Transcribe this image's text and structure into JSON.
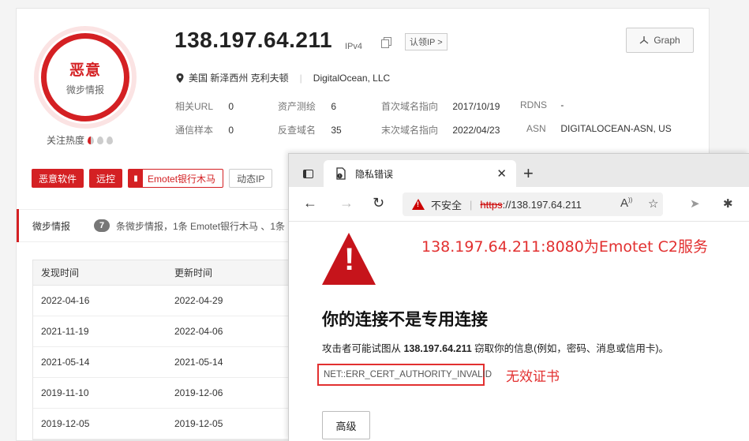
{
  "profile": {
    "verdict": "恶意",
    "verdict_sub": "微步情报",
    "heat_label": "关注热度",
    "heat_level": "1/3"
  },
  "header": {
    "ip": "138.197.64.211",
    "ip_version": "IPv4",
    "claim_label": "认领IP >",
    "graph_label": "Graph",
    "location": "美国 新泽西州 克利夫顿",
    "owner": "DigitalOcean, LLC"
  },
  "meta": {
    "related_url_k": "相关URL",
    "related_url_v": "0",
    "asset_k": "资产测绘",
    "asset_v": "6",
    "first_k": "首次域名指向",
    "first_v": "2017/10/19",
    "rdns_k": "RDNS",
    "rdns_v": "-",
    "sample_k": "通信样本",
    "sample_v": "0",
    "reverse_k": "反查域名",
    "reverse_v": "35",
    "last_k": "末次域名指向",
    "last_v": "2022/04/23",
    "asn_k": "ASN",
    "asn_v": "DIGITALOCEAN-ASN, US"
  },
  "tags": [
    "恶意软件",
    "远控",
    "Emotet银行木马",
    "动态IP"
  ],
  "intel": {
    "label": "微步情报",
    "count": "7",
    "text": "条微步情报，1条 Emotet银行木马 、1条"
  },
  "table": {
    "headers": [
      "发现时间",
      "更新时间"
    ],
    "rows": [
      [
        "2022-04-16",
        "2022-04-29"
      ],
      [
        "2021-11-19",
        "2022-04-06"
      ],
      [
        "2021-05-14",
        "2021-05-14"
      ],
      [
        "2019-11-10",
        "2019-12-06"
      ],
      [
        "2019-12-05",
        "2019-12-05"
      ]
    ]
  },
  "browser": {
    "tab_title": "隐私错误",
    "not_safe": "不安全",
    "url_scheme": "https",
    "url_rest": "://138.197.64.211",
    "annotation_c2": "138.197.64.211:8080为Emotet C2服务",
    "error_title": "你的连接不是专用连接",
    "desc_pre": "攻击者可能试图从 ",
    "desc_ip": "138.197.64.211",
    "desc_post": " 窃取你的信息(例如，密码、消息或信用卡)。",
    "error_code": "NET::ERR_CERT_AUTHORITY_INVALID",
    "annotation_cert": "无效证书",
    "advanced_label": "高级"
  }
}
